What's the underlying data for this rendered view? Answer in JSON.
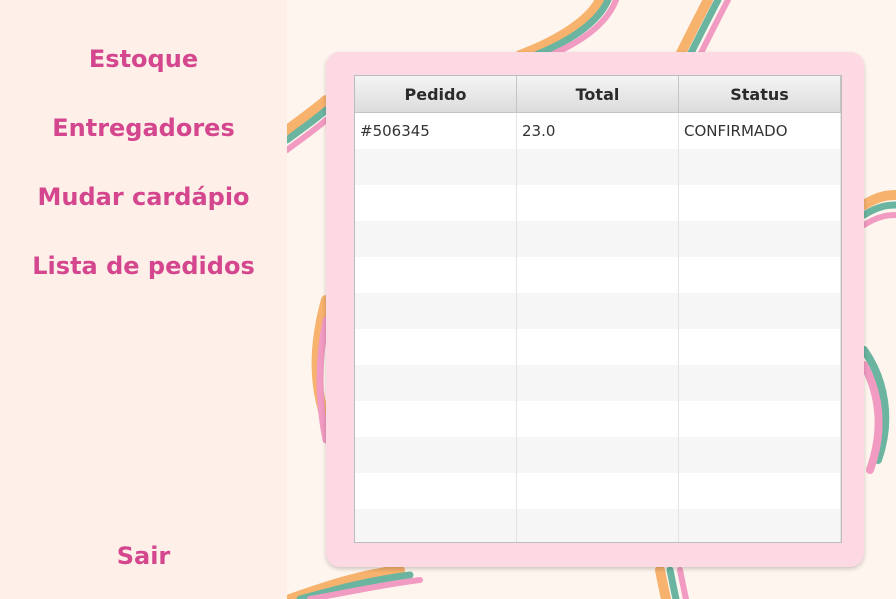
{
  "sidebar": {
    "items": [
      {
        "label": "Estoque"
      },
      {
        "label": "Entregadores"
      },
      {
        "label": "Mudar cardápio"
      },
      {
        "label": "Lista de pedidos"
      }
    ],
    "logout_label": "Sair"
  },
  "orders_table": {
    "columns": [
      "Pedido",
      "Total",
      "Status"
    ],
    "rows": [
      {
        "pedido": "#506345",
        "total": "23.0",
        "status": "CONFIRMADO"
      }
    ],
    "empty_rows": 11
  },
  "colors": {
    "nav_text": "#d4478f",
    "card_bg": "#fdd9e4",
    "sidebar_bg": "#fef0e8",
    "swirl_orange": "#f7b26e",
    "swirl_teal": "#6ab4a0",
    "swirl_pink": "#f29bc2"
  }
}
